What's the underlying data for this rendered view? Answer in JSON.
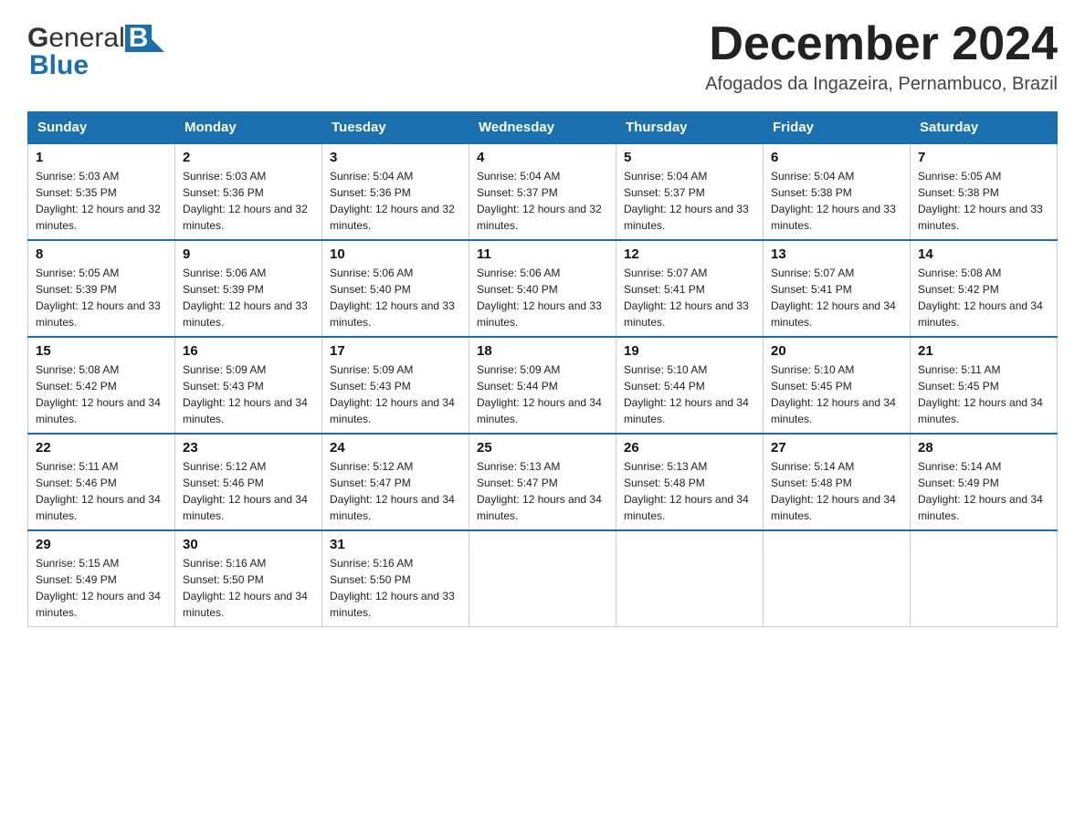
{
  "header": {
    "title": "December 2024",
    "subtitle": "Afogados da Ingazeira, Pernambuco, Brazil",
    "logo_general": "General",
    "logo_blue": "Blue"
  },
  "calendar": {
    "days_of_week": [
      "Sunday",
      "Monday",
      "Tuesday",
      "Wednesday",
      "Thursday",
      "Friday",
      "Saturday"
    ],
    "weeks": [
      [
        {
          "day": "1",
          "sunrise": "5:03 AM",
          "sunset": "5:35 PM",
          "daylight": "12 hours and 32 minutes."
        },
        {
          "day": "2",
          "sunrise": "5:03 AM",
          "sunset": "5:36 PM",
          "daylight": "12 hours and 32 minutes."
        },
        {
          "day": "3",
          "sunrise": "5:04 AM",
          "sunset": "5:36 PM",
          "daylight": "12 hours and 32 minutes."
        },
        {
          "day": "4",
          "sunrise": "5:04 AM",
          "sunset": "5:37 PM",
          "daylight": "12 hours and 32 minutes."
        },
        {
          "day": "5",
          "sunrise": "5:04 AM",
          "sunset": "5:37 PM",
          "daylight": "12 hours and 33 minutes."
        },
        {
          "day": "6",
          "sunrise": "5:04 AM",
          "sunset": "5:38 PM",
          "daylight": "12 hours and 33 minutes."
        },
        {
          "day": "7",
          "sunrise": "5:05 AM",
          "sunset": "5:38 PM",
          "daylight": "12 hours and 33 minutes."
        }
      ],
      [
        {
          "day": "8",
          "sunrise": "5:05 AM",
          "sunset": "5:39 PM",
          "daylight": "12 hours and 33 minutes."
        },
        {
          "day": "9",
          "sunrise": "5:06 AM",
          "sunset": "5:39 PM",
          "daylight": "12 hours and 33 minutes."
        },
        {
          "day": "10",
          "sunrise": "5:06 AM",
          "sunset": "5:40 PM",
          "daylight": "12 hours and 33 minutes."
        },
        {
          "day": "11",
          "sunrise": "5:06 AM",
          "sunset": "5:40 PM",
          "daylight": "12 hours and 33 minutes."
        },
        {
          "day": "12",
          "sunrise": "5:07 AM",
          "sunset": "5:41 PM",
          "daylight": "12 hours and 33 minutes."
        },
        {
          "day": "13",
          "sunrise": "5:07 AM",
          "sunset": "5:41 PM",
          "daylight": "12 hours and 34 minutes."
        },
        {
          "day": "14",
          "sunrise": "5:08 AM",
          "sunset": "5:42 PM",
          "daylight": "12 hours and 34 minutes."
        }
      ],
      [
        {
          "day": "15",
          "sunrise": "5:08 AM",
          "sunset": "5:42 PM",
          "daylight": "12 hours and 34 minutes."
        },
        {
          "day": "16",
          "sunrise": "5:09 AM",
          "sunset": "5:43 PM",
          "daylight": "12 hours and 34 minutes."
        },
        {
          "day": "17",
          "sunrise": "5:09 AM",
          "sunset": "5:43 PM",
          "daylight": "12 hours and 34 minutes."
        },
        {
          "day": "18",
          "sunrise": "5:09 AM",
          "sunset": "5:44 PM",
          "daylight": "12 hours and 34 minutes."
        },
        {
          "day": "19",
          "sunrise": "5:10 AM",
          "sunset": "5:44 PM",
          "daylight": "12 hours and 34 minutes."
        },
        {
          "day": "20",
          "sunrise": "5:10 AM",
          "sunset": "5:45 PM",
          "daylight": "12 hours and 34 minutes."
        },
        {
          "day": "21",
          "sunrise": "5:11 AM",
          "sunset": "5:45 PM",
          "daylight": "12 hours and 34 minutes."
        }
      ],
      [
        {
          "day": "22",
          "sunrise": "5:11 AM",
          "sunset": "5:46 PM",
          "daylight": "12 hours and 34 minutes."
        },
        {
          "day": "23",
          "sunrise": "5:12 AM",
          "sunset": "5:46 PM",
          "daylight": "12 hours and 34 minutes."
        },
        {
          "day": "24",
          "sunrise": "5:12 AM",
          "sunset": "5:47 PM",
          "daylight": "12 hours and 34 minutes."
        },
        {
          "day": "25",
          "sunrise": "5:13 AM",
          "sunset": "5:47 PM",
          "daylight": "12 hours and 34 minutes."
        },
        {
          "day": "26",
          "sunrise": "5:13 AM",
          "sunset": "5:48 PM",
          "daylight": "12 hours and 34 minutes."
        },
        {
          "day": "27",
          "sunrise": "5:14 AM",
          "sunset": "5:48 PM",
          "daylight": "12 hours and 34 minutes."
        },
        {
          "day": "28",
          "sunrise": "5:14 AM",
          "sunset": "5:49 PM",
          "daylight": "12 hours and 34 minutes."
        }
      ],
      [
        {
          "day": "29",
          "sunrise": "5:15 AM",
          "sunset": "5:49 PM",
          "daylight": "12 hours and 34 minutes."
        },
        {
          "day": "30",
          "sunrise": "5:16 AM",
          "sunset": "5:50 PM",
          "daylight": "12 hours and 34 minutes."
        },
        {
          "day": "31",
          "sunrise": "5:16 AM",
          "sunset": "5:50 PM",
          "daylight": "12 hours and 33 minutes."
        },
        null,
        null,
        null,
        null
      ]
    ]
  }
}
